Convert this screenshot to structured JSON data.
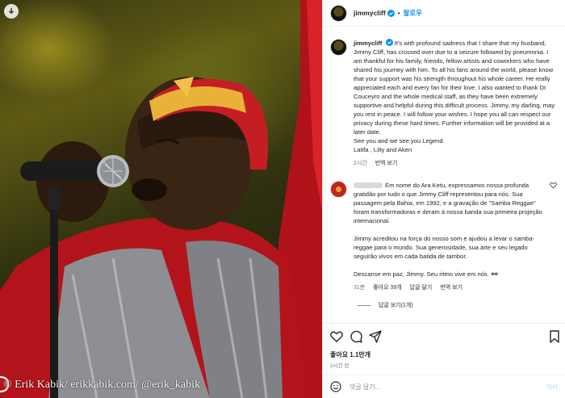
{
  "photo": {
    "watermark": "© Erik Kabik/ erikkabik.com/ @erik_kabik",
    "icons": {
      "download": "download-circle-icon"
    }
  },
  "header": {
    "username": "jimmycliff",
    "separator": "•",
    "follow_label": "팔로우"
  },
  "post": {
    "username": "jimmycliff",
    "caption_lines": [
      "It's with profound sadness that I share that my husband, Jimmy Cliff, has crossed over due to a seizure followed by pneumonia. I am thankful for his family, friends, fellow artists and coworkers who have shared his journey with him. To all his fans around the world, please know that your support was his strength throughout his whole career. He really appreciated each and every fan for their love. I also wanted to thank Dr. Couceyro and the whole medical staff, as they have been extremely supportive and helpful during this difficult process. Jimmy, my darling, may you rest in peace. I will follow your wishes. I hope you all can respect our privacy during these hard times. Further information will be provided at a later date.",
      "See you and we see you Legend.",
      "Latifa , Lilty and Aken"
    ],
    "time": "2시간",
    "translate_label": "번역 보기"
  },
  "comment": {
    "paragraphs": [
      "Em nome do Ara Ketu, expressamos nossa profunda gratidão por tudo o que Jimmy Cliff representou para nós. Sua passagem pela Bahia, em 1992, e a gravação de \"Samba Reggae\" foram transformadoras e deram à nossa banda sua primeira projeção internacional.",
      "Jimmy acreditou na força do nosso som e ajudou a levar o samba-reggae para o mundo. Sua generosidade, sua arte e seu legado seguirão vivos em cada batida de tambor.",
      "Descanse em paz, Jimmy. Seu ritmo vive em nós. 🕶"
    ],
    "time": "31분",
    "likes": "좋아요 39개",
    "reply_label": "답글 달기",
    "translate_label": "번역 보기",
    "view_replies_label": "답글 보기(1개)"
  },
  "actions": {
    "icons": [
      "heart-icon",
      "comment-icon",
      "share-icon",
      "bookmark-icon"
    ]
  },
  "likes_total": "좋아요 1.1만개",
  "post_time": "2시간 전",
  "comment_input": {
    "placeholder": "댓글 달기...",
    "post_label": "게시"
  },
  "colors": {
    "link_blue": "#0095f6",
    "verified_blue": "#0095f6",
    "muted_text": "#737373",
    "post_button_disabled": "#b2dffc"
  }
}
